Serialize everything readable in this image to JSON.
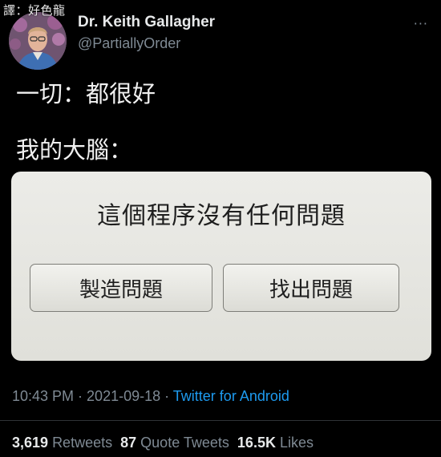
{
  "watermark": "譯：好色龍",
  "user": {
    "name": "Dr. Keith Gallagher",
    "handle": "@PartiallyOrder",
    "more": "···"
  },
  "tweet": {
    "line1": "一切：都很好",
    "line2": "我的大腦："
  },
  "card": {
    "title": "這個程序沒有任何問題",
    "left_button": "製造問題",
    "right_button": "找出問題"
  },
  "meta": {
    "time": "10:43 PM",
    "sep1": " · ",
    "date": "2021-09-18",
    "sep2": " · ",
    "source": "Twitter for Android"
  },
  "stats": {
    "retweets_count": "3,619",
    "retweets_label": "Retweets",
    "quotes_count": "87",
    "quotes_label": "Quote Tweets",
    "likes_count": "16.5K",
    "likes_label": "Likes"
  }
}
